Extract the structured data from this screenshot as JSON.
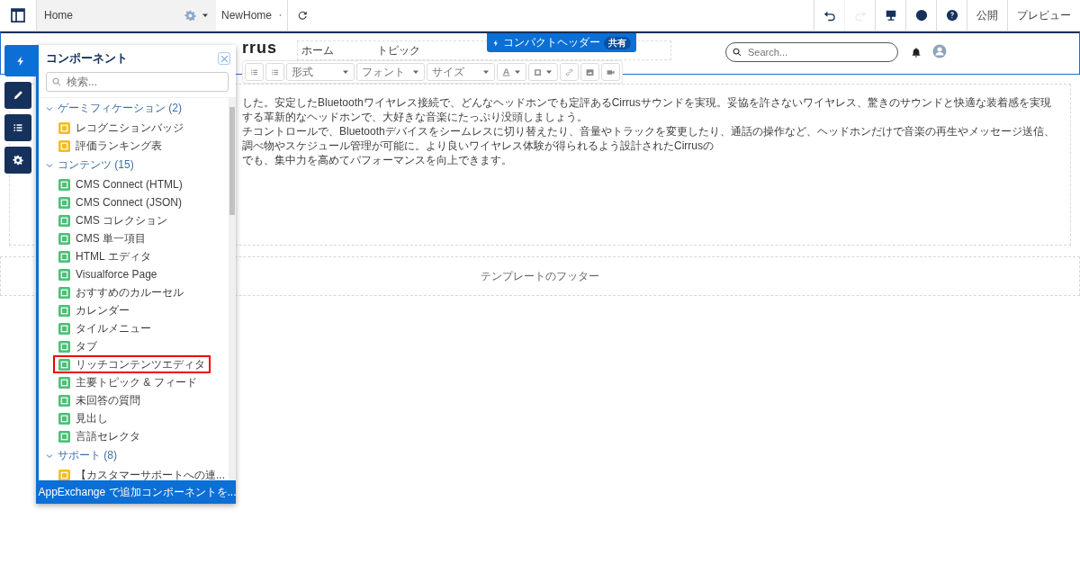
{
  "topbar": {
    "page": "Home",
    "page_menu": "NewHome",
    "actions": [
      {
        "disabled": false
      },
      {
        "disabled": true
      },
      {
        "disabled": false
      },
      {
        "disabled": false
      },
      {
        "disabled": false
      }
    ],
    "publish": "公開",
    "preview": "プレビュー"
  },
  "rail": [
    {
      "selected": true
    },
    {
      "selected": false
    },
    {
      "selected": false
    },
    {
      "selected": false
    }
  ],
  "panel": {
    "title": "コンポーネント",
    "search_placeholder": "検索...",
    "groups": [
      {
        "label": "ゲーミフィケーション (2)",
        "expanded": true,
        "items": [
          {
            "label": "レコグニションバッジ",
            "color": "#f4bc25",
            "highlighted": false
          },
          {
            "label": "評価ランキング表",
            "color": "#f4bc25",
            "highlighted": false
          }
        ]
      },
      {
        "label": "コンテンツ (15)",
        "expanded": true,
        "items": [
          {
            "label": "CMS Connect (HTML)",
            "color": "#4bc076",
            "highlighted": false
          },
          {
            "label": "CMS Connect (JSON)",
            "color": "#4bc076",
            "highlighted": false
          },
          {
            "label": "CMS コレクション",
            "color": "#4bc076",
            "highlighted": false
          },
          {
            "label": "CMS 単一項目",
            "color": "#4bc076",
            "highlighted": false
          },
          {
            "label": "HTML エディタ",
            "color": "#4bc076",
            "highlighted": false
          },
          {
            "label": "Visualforce Page",
            "color": "#4bc076",
            "highlighted": false
          },
          {
            "label": "おすすめのカルーセル",
            "color": "#4bc076",
            "highlighted": false
          },
          {
            "label": "カレンダー",
            "color": "#4bc076",
            "highlighted": false
          },
          {
            "label": "タイルメニュー",
            "color": "#4bc076",
            "highlighted": false
          },
          {
            "label": "タブ",
            "color": "#4bc076",
            "highlighted": false
          },
          {
            "label": "リッチコンテンツエディタ",
            "color": "#4bc076",
            "highlighted": true
          },
          {
            "label": "主要トピック & フィード",
            "color": "#4bc076",
            "highlighted": false
          },
          {
            "label": "未回答の質問",
            "color": "#4bc076",
            "highlighted": false
          },
          {
            "label": "見出し",
            "color": "#4bc076",
            "highlighted": false
          },
          {
            "label": "言語セレクタ",
            "color": "#4bc076",
            "highlighted": false
          }
        ]
      },
      {
        "label": "サポート (8)",
        "expanded": true,
        "items": [
          {
            "label": "【カスタマーサポートへの連...",
            "color": "#f4bc25",
            "highlighted": false
          }
        ]
      }
    ],
    "footer_link": "AppExchange で追加コンポーネントを..."
  },
  "header": {
    "badge": "コンパクトヘッダー",
    "badge_tag": "共有",
    "logo": "rrus",
    "nav": [
      "ホーム",
      "トピック"
    ],
    "search_placeholder": "Search..."
  },
  "toolbar": {
    "dropdowns": [
      "形式",
      "フォント",
      "サイズ"
    ]
  },
  "body": [
    "した。安定したBluetoothワイヤレス接続で、どんなヘッドホンでも定評あるCirrusサウンドを実現。妥協を許さないワイヤレス、驚きのサウンドと快適な装着感を実現する革新的なヘッドホンで、大好きな音楽にたっぷり没頭しましょう。",
    "チコントロールで、Bluetoothデバイスをシームレスに切り替えたり、音量やトラックを変更したり、通話の操作など、ヘッドホンだけで音楽の再生やメッセージ送信、調べ物やスケジュール管理が可能に。より良いワイヤレス体験が得られるよう設計されたCirrusの",
    "でも、集中力を高めてパフォーマンスを向上できます。"
  ],
  "footer": "テンプレートのフッター"
}
